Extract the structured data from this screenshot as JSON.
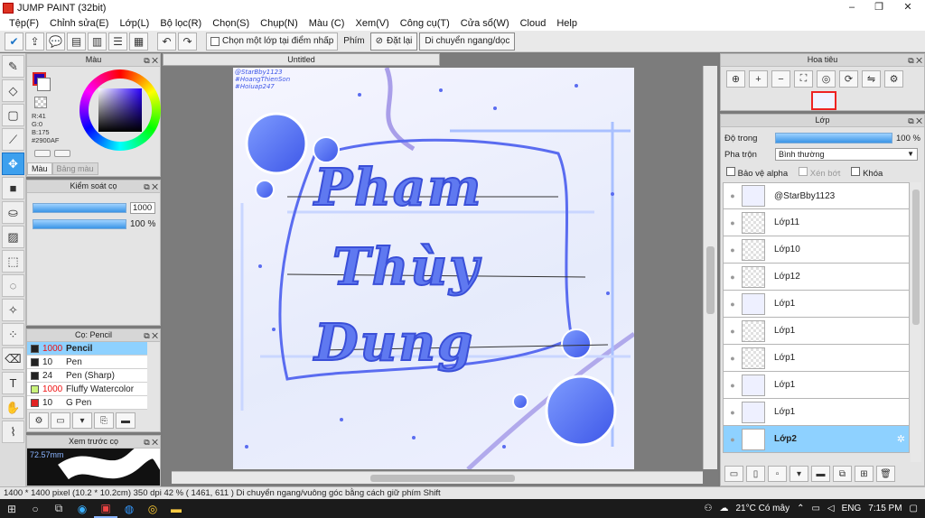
{
  "window": {
    "title": "JUMP PAINT (32bit)",
    "controls": [
      "–",
      "❐",
      "✕"
    ]
  },
  "menu": [
    "Tệp(F)",
    "Chỉnh sửa(E)",
    "Lớp(L)",
    "Bộ lọc(R)",
    "Chọn(S)",
    "Chụp(N)",
    "Màu (C)",
    "Xem(V)",
    "Công cụ(T)",
    "Cửa sổ(W)",
    "Cloud",
    "Help"
  ],
  "toolbar": {
    "pick_layer_label": "Chọn một lớp tại điểm nhấp",
    "snap_label": "Phím",
    "reset_label": "Đặt lại",
    "move_label": "Di chuyển ngang/dọc"
  },
  "color_panel": {
    "title": "Màu",
    "fg_color": "#2900AF",
    "rgb_text": [
      "R:41",
      "G:0",
      "B:175",
      "#2900AF"
    ],
    "tabs": [
      "Màu",
      "Bảng màu"
    ]
  },
  "control_panel": {
    "title": "Kiểm soát cọ",
    "size_value": "1000",
    "opacity_value": "100 %"
  },
  "brush_panel": {
    "title": "Cọ: Pencil",
    "brushes": [
      {
        "size": "1000",
        "name": "Pencil",
        "color": "#222222",
        "selected": true,
        "size_red": true
      },
      {
        "size": "10",
        "name": "Pen",
        "color": "#222222",
        "selected": false,
        "size_red": false
      },
      {
        "size": "24",
        "name": "Pen (Sharp)",
        "color": "#222222",
        "selected": false,
        "size_red": false
      },
      {
        "size": "1000",
        "name": "Fluffy Watercolor",
        "color": "#c9f27a",
        "selected": false,
        "size_red": true
      },
      {
        "size": "10",
        "name": "G Pen",
        "color": "#e22222",
        "selected": false,
        "size_red": false
      }
    ]
  },
  "preview_panel": {
    "title": "Xem trước cọ",
    "zoom": "72.57mm"
  },
  "canvas": {
    "tab_title": "Untitled",
    "credits": [
      "@StarBby1123",
      "#HoangThienSon",
      "#Hoiuap247"
    ],
    "artwork_text": [
      "Pham",
      "Thùy",
      "Dung"
    ]
  },
  "navigator": {
    "title": "Hoa tiêu"
  },
  "layer_panel": {
    "title": "Lớp",
    "opacity_label": "Độ trong",
    "opacity_value": "100 %",
    "blend_label": "Pha trộn",
    "blend_value": "Bình thường",
    "lock_alpha": "Bảo vệ alpha",
    "clip": "Xén bớt",
    "lock": "Khóa",
    "layers": [
      {
        "name": "@StarBby1123",
        "thumb": "text",
        "selected": false
      },
      {
        "name": "Lớp11",
        "thumb": "empty",
        "selected": false
      },
      {
        "name": "Lớp10",
        "thumb": "empty",
        "selected": false
      },
      {
        "name": "Lớp12",
        "thumb": "empty",
        "selected": false
      },
      {
        "name": "Lớp1",
        "thumb": "art",
        "selected": false
      },
      {
        "name": "Lớp1",
        "thumb": "empty",
        "selected": false
      },
      {
        "name": "Lớp1",
        "thumb": "empty",
        "selected": false
      },
      {
        "name": "Lớp1",
        "thumb": "art",
        "selected": false
      },
      {
        "name": "Lớp1",
        "thumb": "art",
        "selected": false
      },
      {
        "name": "Lớp2",
        "thumb": "white",
        "selected": true
      }
    ]
  },
  "status": {
    "text": "1400 * 1400 pixel  (10.2 * 10.2cm)  350 dpi  42 %  ( 1461, 611 )  Di chuyển ngang/vuông góc bằng cách giữ phím Shift"
  },
  "taskbar": {
    "weather": "21°C  Có mây",
    "lang": "ENG",
    "time": "7:15 PM"
  }
}
